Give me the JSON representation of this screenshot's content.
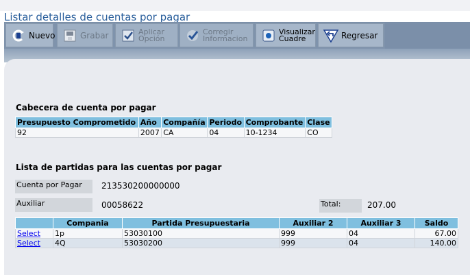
{
  "page": {
    "title": "Listar detalles de cuentas por pagar"
  },
  "toolbar": {
    "buttons": [
      {
        "label": "Nuevo",
        "icon": "new-icon",
        "enabled": true
      },
      {
        "label": "Grabar",
        "icon": "save-icon",
        "enabled": false
      },
      {
        "label": "Aplicar Opción",
        "line1": "Aplicar",
        "line2": "Opción",
        "icon": "apply-icon",
        "enabled": false
      },
      {
        "label": "Corregir Informacion",
        "line1": "Corregir",
        "line2": "Informacion",
        "icon": "correct-icon",
        "enabled": false
      },
      {
        "label": "Visualizar Cuadre",
        "line1": "Visualizar",
        "line2": "Cuadre",
        "icon": "view-icon",
        "enabled": true
      },
      {
        "label": "Regresar",
        "icon": "back-icon",
        "enabled": true
      }
    ]
  },
  "header_section": {
    "title": "Cabecera de cuenta por pagar",
    "columns": [
      "Presupuesto Comprometido",
      "Año",
      "Compañía",
      "Periodo",
      "Comprobante",
      "Clase"
    ],
    "row": [
      "92",
      "2007",
      "CA",
      "04",
      "10-1234",
      "CO"
    ]
  },
  "items_section": {
    "title": "Lista de partidas para las cuentas por pagar",
    "cuenta_label": "Cuenta por Pagar",
    "cuenta_value": "213530200000000",
    "auxiliar_label": "Auxiliar",
    "auxiliar_value": "00058622",
    "total_label": "Total:",
    "total_value": "207.00",
    "columns": [
      "",
      "Compania",
      "Partida Presupuestaria",
      "Auxiliar 2",
      "Auxiliar 3",
      "Saldo"
    ],
    "rows": [
      {
        "action": "Select",
        "compania": "1p",
        "partida": "53030100",
        "aux2": "999",
        "aux3": "04",
        "saldo": "67.00"
      },
      {
        "action": "Select",
        "compania": "4Q",
        "partida": "53030200",
        "aux2": "999",
        "aux3": "04",
        "saldo": "140.00"
      }
    ]
  },
  "colors": {
    "title": "#2a5f9c",
    "toolbar": "#7f93ac",
    "table_header": "#7fbfdf",
    "background": "#e9ebf0"
  }
}
